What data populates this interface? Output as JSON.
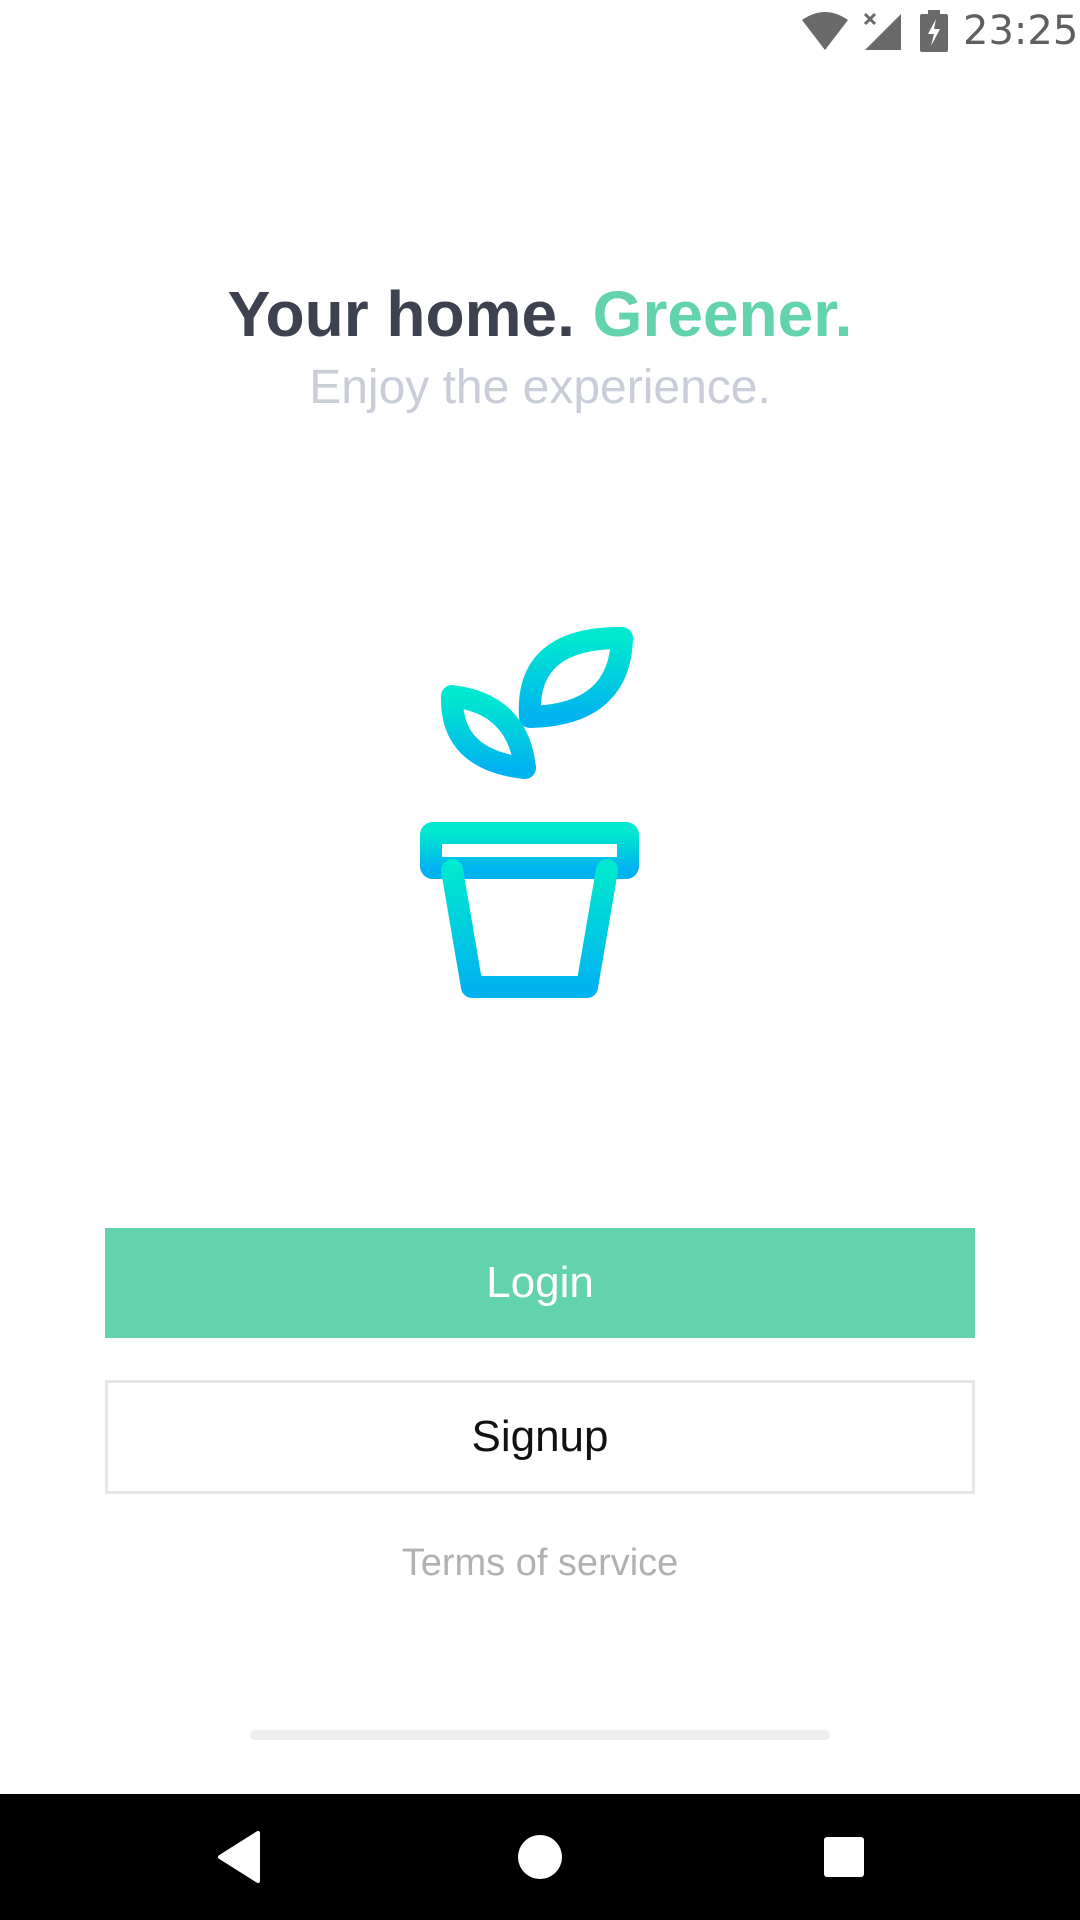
{
  "status_bar": {
    "time": "23:25",
    "icons": [
      "wifi-icon",
      "cellular-no-signal-icon",
      "battery-charging-icon"
    ]
  },
  "hero": {
    "headline_main": "Your home.",
    "headline_accent": "Greener.",
    "subtitle": "Enjoy the experience.",
    "illustration": "potted-plant-icon"
  },
  "actions": {
    "login_label": "Login",
    "signup_label": "Signup",
    "terms_label": "Terms of service"
  },
  "nav_bar": {
    "icons": [
      "back-icon",
      "home-icon",
      "recents-icon"
    ]
  },
  "colors": {
    "brand_green": "#63d3ad",
    "headline_dark": "#3d4150",
    "subtitle_gray": "#c8cdd8",
    "plant_gradient_top": "#00e8cf",
    "plant_gradient_bottom": "#00b3f0"
  }
}
